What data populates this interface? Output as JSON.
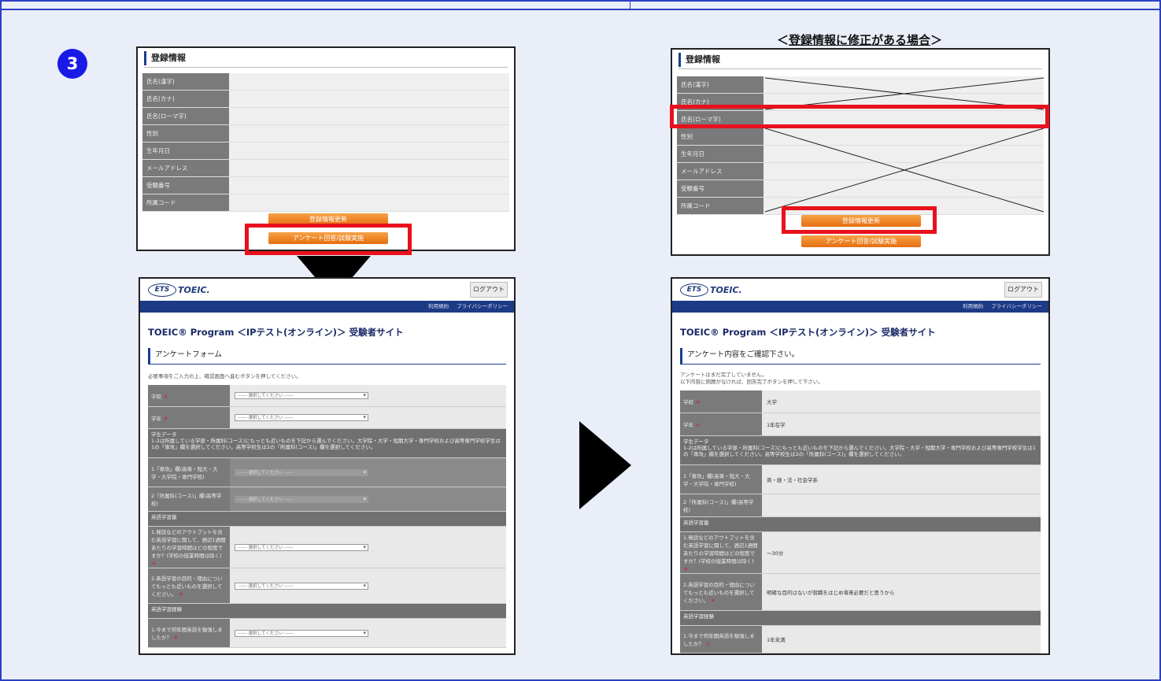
{
  "step_number": "3",
  "caption": {
    "pre": "＜",
    "main": "登録情報に修正がある場合",
    "post": "＞"
  },
  "registration": {
    "title": "登録情報",
    "fields": [
      "氏名(漢字)",
      "氏名(カナ)",
      "氏名(ローマ字)",
      "性別",
      "生年月日",
      "メールアドレス",
      "受験番号",
      "所属コード"
    ],
    "update_button": "登録情報更新",
    "survey_button": "アンケート回答/試験実施"
  },
  "site": {
    "logo_ets": "ETS",
    "logo_toeic": "TOEIC.",
    "logout": "ログアウト",
    "nav": [
      "利用規約",
      "プライバシーポリシー"
    ],
    "title": "TOEIC® Program ＜IPテスト(オンライン)＞ 受験者サイト"
  },
  "form": {
    "heading": "アンケートフォーム",
    "intro": "必要事項をご入力の上、確認画面へ進むボタンを押してください。",
    "select_placeholder": "------ 選択してください ------",
    "school_label": "学校",
    "grade_label": "学年",
    "student_data_title": "学生データ",
    "student_data_desc": "1-2は所属している学部・所属科(コース)にもっとも近いものを下記から選んでください。大学院・大学・短期大学・専門学校および高等専門学校学生は1の「専攻」欄を選択してください。高等学校生は2の「所属科(コース)」欄を選択してください。",
    "q_major": "1「専攻」欄(高専・短大・大学・大学院・専門学校)",
    "q_course": "2「所属科(コース)」欄(高等学校)",
    "english_study_title": "英語学習量",
    "q_hours": "1.発話などのアウトプットを含む英語学習に関して、週辺1週間あたりの学習時間はどの程度ですか？(学校の授業時間は除く)",
    "q_purpose": "2.英語学習の目的・理由についてもっとも近いものを選択してください。",
    "english_history_title": "英語学習経験",
    "q_years": "1.今まで何年間英語を勉強しましたか？"
  },
  "confirm": {
    "heading": "アンケート内容をご確認下さい。",
    "intro_line1": "アンケートはまだ完了していません。",
    "intro_line2": "以下内容に問題がなければ、回答完了ボタンを押して下さい。",
    "school_value": "大学",
    "grade_value": "1年在学",
    "major_value": "商・経・法・社会学系",
    "hours_value": "～30分",
    "purpose_value": "明確な目的はないが就職をはじめ将来必要だと思うから",
    "years_value": "1年未満"
  }
}
